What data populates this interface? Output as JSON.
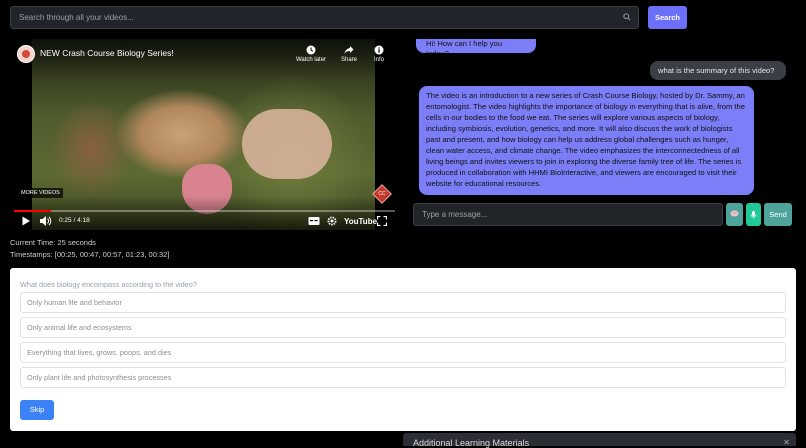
{
  "search": {
    "placeholder": "Search through all your videos...",
    "button_label": "Search"
  },
  "video": {
    "title": "NEW Crash Course Biology Series!",
    "watch_later_label": "Watch later",
    "share_label": "Share",
    "info_label": "Info",
    "more_videos_label": "MORE VIDEOS",
    "time_display": "0:25 / 4:18",
    "progress_fraction": 0.097,
    "logo_text": "YouTube",
    "cc_badge": "CC"
  },
  "playback": {
    "current_time": "Current Time: 25 seconds",
    "timestamps": "Timestamps: [00:25, 00:47, 00:57, 01:23, 00:32]"
  },
  "chat": {
    "greeting": "Hi! How can I help you today?",
    "user_message": "what is the summary of this video?",
    "bot_message": "The video is an introduction to a new series of Crash Course Biology, hosted by Dr. Sammy, an entomologist. The video highlights the importance of biology in everything that is alive, from the cells in our bodies to the food we eat. The series will explore various aspects of biology, including symbiosis, evolution, genetics, and more. It will also discuss the work of biologists past and present, and how biology can help us address global challenges such as hunger, clean water access, and climate change. The video emphasizes the interconnectedness of all living beings and invites viewers to join in exploring the diverse family tree of life. The series is produced in collaboration with HHMI BioInteractive, and viewers are encouraged to visit their website for educational resources.",
    "input_placeholder": "Type a message...",
    "send_label": "Send"
  },
  "quiz": {
    "question": "What does biology encompass according to the video?",
    "options": [
      "Only human life and behavior",
      "Only animal life and ecosystems",
      "Everything that lives, grows, poops, and dies",
      "Only plant life and photosynthesis processes"
    ],
    "skip_label": "Skip"
  },
  "additional": {
    "title": "Additional Learning Materials"
  },
  "colors": {
    "accent": "#7b7ef7",
    "send": "#4ea39a",
    "mic": "#20c997",
    "skip": "#3b82f6"
  }
}
